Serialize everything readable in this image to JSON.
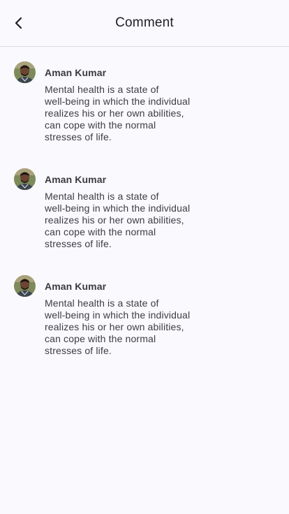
{
  "header": {
    "title": "Comment",
    "back_icon": "chevron-left-icon"
  },
  "comments": [
    {
      "author": "Aman Kumar",
      "lines": [
        "Mental health is a state of",
        "well-being in which the individual",
        "realizes his or her own abilities,",
        "can cope with the normal",
        "stresses of life."
      ]
    },
    {
      "author": "Aman Kumar",
      "lines": [
        "Mental health is a state of",
        "well-being in which the individual",
        "realizes his or her own abilities,",
        "can cope with the normal",
        "stresses of life."
      ]
    },
    {
      "author": "Aman Kumar",
      "lines": [
        "Mental health is a state of",
        "well-being in which the individual",
        "realizes his or her own abilities,",
        "can cope with the normal",
        "stresses of life."
      ]
    }
  ]
}
